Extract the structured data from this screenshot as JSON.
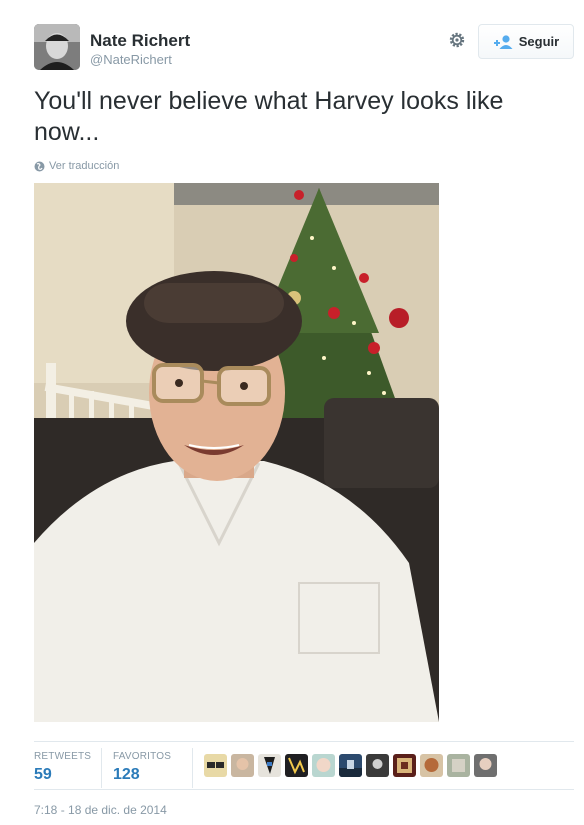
{
  "author": {
    "name": "Nate Richert",
    "handle": "@NateRichert"
  },
  "actions": {
    "follow_label": "Seguir"
  },
  "tweet": {
    "text": "You'll never believe what Harvey looks like now...",
    "translate_label": "Ver traducción"
  },
  "stats": {
    "retweets_label": "RETWEETS",
    "retweets_value": "59",
    "favorites_label": "FAVORITOS",
    "favorites_value": "128"
  },
  "timestamp": "7:18 - 18 de dic. de 2014",
  "colors": {
    "accent": "#2b7bb9",
    "muted": "#8899a6",
    "text": "#292f33",
    "border": "#e1e8ed"
  },
  "icons": {
    "settings": "gear-icon",
    "follow": "add-user-icon",
    "translate": "globe-icon"
  }
}
